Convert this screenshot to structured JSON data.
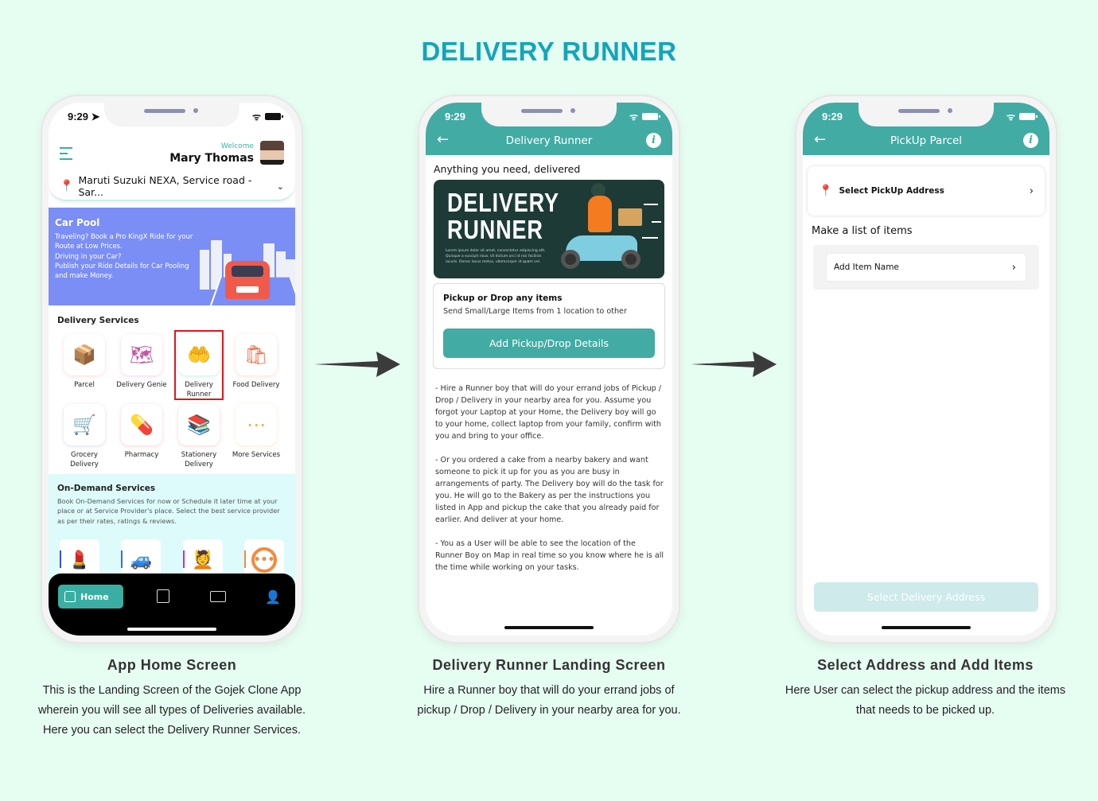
{
  "page": {
    "title": "DELIVERY RUNNER",
    "title_color": "#14a5b8",
    "accent_color": "#42aba4"
  },
  "phone1": {
    "status_time": "9:29",
    "header": {
      "welcome": "Welcome",
      "user_name": "Mary Thomas",
      "location": "Maruti Suzuki NEXA, Service road - Sar..."
    },
    "carpool": {
      "title": "Car Pool",
      "lines": [
        "Traveling? Book a Pro KingX Ride for your Route at Low Prices.",
        "Driving in your Car?",
        "Publish your Ride Details for Car Pooling and make Money."
      ]
    },
    "delivery_services": {
      "title": "Delivery Services",
      "items": [
        {
          "label": "Parcel",
          "icon": "parcel-box-icon",
          "glyph": "📦",
          "color": "#f06b6b"
        },
        {
          "label": "Delivery Genie",
          "icon": "map-pin-icon",
          "glyph": "🗺",
          "color": "#c15aa0"
        },
        {
          "label": "Delivery Runner",
          "icon": "hand-package-icon",
          "glyph": "🤲",
          "color": "#38b38c",
          "selected": true
        },
        {
          "label": "Food Delivery",
          "icon": "food-bag-icon",
          "glyph": "🛍",
          "color": "#f2704c"
        },
        {
          "label": "Grocery Delivery",
          "icon": "grocery-cart-icon",
          "glyph": "🛒",
          "color": "#6a74e0"
        },
        {
          "label": "Pharmacy",
          "icon": "pharmacy-icon",
          "glyph": "💊",
          "color": "#e5484d"
        },
        {
          "label": "Stationery Delivery",
          "icon": "stationery-icon",
          "glyph": "📚",
          "color": "#e5484d"
        },
        {
          "label": "More Services",
          "icon": "more-services-icon",
          "glyph": "⋯",
          "color": "#f5b042"
        }
      ]
    },
    "on_demand": {
      "title": "On-Demand Services",
      "description": "Book On-Demand Services for now or Schedule it later time at your place or at Service Provider's place. Select the best service provider as per their rates, ratings & reviews.",
      "items": [
        {
          "icon": "beauty-makeup-icon",
          "glyph": "💄",
          "color": "#3f4fb8"
        },
        {
          "icon": "car-wash-icon",
          "glyph": "🚙",
          "color": "#3f6fb8"
        },
        {
          "icon": "spa-massage-icon",
          "glyph": "💆",
          "color": "#d62ba8"
        },
        {
          "icon": "more-icon",
          "glyph": "•••",
          "color": "#f58a3a"
        }
      ]
    },
    "bottom_nav": {
      "home_label": "Home"
    }
  },
  "phone2": {
    "status_time": "9:29",
    "header_title": "Delivery Runner",
    "tagline": "Anything you need, delivered",
    "banner": {
      "line1": "DELIVERY",
      "line2": "RUNNER",
      "lorem": "Lorem ipsum dolor sit amet, consectetur adipiscing elit. Quisque a suscipit risus. Ut dictum orci id nisi facilisis iaculis. Donec lacus metus, ullamcorper id quam vel."
    },
    "pickup_card": {
      "title": "Pickup or Drop any items",
      "subtitle": "Send Small/Large Items from 1 location to other",
      "button": "Add Pickup/Drop Details"
    },
    "description": [
      "- Hire a Runner boy that will do your errand jobs of Pickup / Drop / Delivery in your nearby area for you. Assume you forgot your Laptop at your Home, the Delivery boy will go to your home, collect laptop from your family, confirm with you and bring to your office.",
      "- Or you ordered a cake from a nearby bakery and want someone to pick it up for you as you are busy in arrangements of party. The Delivery boy will do the task for you. He will go to the Bakery as per the instructions you listed in App and pickup the cake that you already paid for earlier. And deliver at your home.",
      "- You as a User will be able to see the location of the Runner Boy on Map in real time so you know where he is all the time while working on your tasks."
    ]
  },
  "phone3": {
    "status_time": "9:29",
    "header_title": "PickUp Parcel",
    "pickup_address": "Select PickUp Address",
    "list_title": "Make a list of items",
    "add_item": "Add Item Name",
    "delivery_button": "Select Delivery Address"
  },
  "captions": [
    {
      "title": "App Home Screen",
      "text": "This is the Landing Screen of the Gojek Clone App wherein you will see all types of Deliveries available. Here you can select the Delivery Runner Services."
    },
    {
      "title": "Delivery Runner Landing Screen",
      "text": "Hire a Runner boy that will do your errand jobs of pickup / Drop / Delivery in your nearby area for you."
    },
    {
      "title": "Select Address and Add Items",
      "text": "Here User can select the pickup address and the items that needs to be picked up."
    }
  ]
}
